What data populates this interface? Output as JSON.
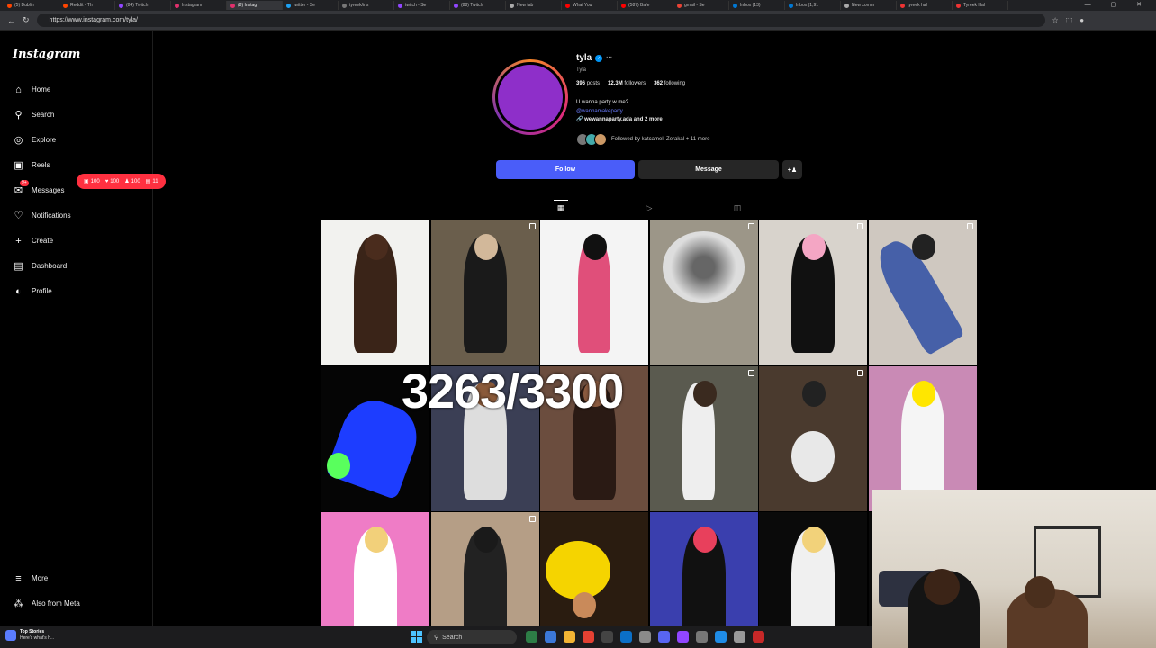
{
  "browser": {
    "tabs": [
      "(5) Dublin",
      "Reddit - Th",
      "(84) Twitch",
      "Instagram",
      "(8) Instagr",
      "twitter - Se",
      "tyreek/ins",
      "twitch - Se",
      "(88) Twitch",
      "New tab",
      "What You",
      "(587) Bafe",
      "gmail - Se",
      "Inbox (13)",
      "Inbox (1,91",
      "New comm",
      "tyreek hal",
      "Tyreek Hal"
    ],
    "active_tab_index": 4,
    "url": "https://www.instagram.com/tyla/"
  },
  "sidebar": {
    "logo": "Instagram",
    "items": [
      {
        "label": "Home",
        "icon": "home-icon",
        "glyph": "⌂"
      },
      {
        "label": "Search",
        "icon": "search-icon",
        "glyph": "⚲"
      },
      {
        "label": "Explore",
        "icon": "compass-icon",
        "glyph": "◎"
      },
      {
        "label": "Reels",
        "icon": "reels-icon",
        "glyph": "▣"
      },
      {
        "label": "Messages",
        "icon": "messenger-icon",
        "glyph": "✉"
      },
      {
        "label": "Notifications",
        "icon": "heart-icon",
        "glyph": "♡"
      },
      {
        "label": "Create",
        "icon": "plus-icon",
        "glyph": "+"
      },
      {
        "label": "Dashboard",
        "icon": "dashboard-icon",
        "glyph": "▤"
      },
      {
        "label": "Profile",
        "icon": "profile-avatar-icon",
        "glyph": "◐"
      }
    ],
    "bottom_items": [
      {
        "label": "More",
        "icon": "menu-icon",
        "glyph": "≡"
      },
      {
        "label": "Also from Meta",
        "icon": "meta-icon",
        "glyph": "⁂"
      }
    ],
    "messages_badge": "9+",
    "notification_pill": {
      "posts": "100",
      "likes": "100",
      "followers": "100",
      "comments": "11"
    }
  },
  "profile": {
    "username": "tyla",
    "full_name": "Tyla",
    "stats": {
      "posts": "396",
      "posts_label": "posts",
      "followers": "12.3M",
      "followers_label": "followers",
      "following": "362",
      "following_label": "following"
    },
    "bio_line": "U wanna party w me?",
    "bio_link": "@wannamakeparty",
    "website": "wewannaparty.ada and 2 more",
    "followed_by": "Followed by katcamel, Zerakal + 11 more",
    "follow_label": "Follow",
    "message_label": "Message",
    "add_user_label": "+̲"
  },
  "content_tabs": [
    {
      "name": "posts",
      "glyph": "▦"
    },
    {
      "name": "reels",
      "glyph": "▷"
    },
    {
      "name": "tagged",
      "glyph": "◫"
    }
  ],
  "overlay_counter": "3263/3300",
  "taskbar": {
    "news_title": "Top Stories",
    "news_sub": "Here's what's h...",
    "search_placeholder": "Search"
  },
  "colors": {
    "follow_button": "#4a5df9",
    "notification_red": "#ff3040",
    "verified_blue": "#0095f6",
    "avatar_purple": "#8e2fc9"
  }
}
